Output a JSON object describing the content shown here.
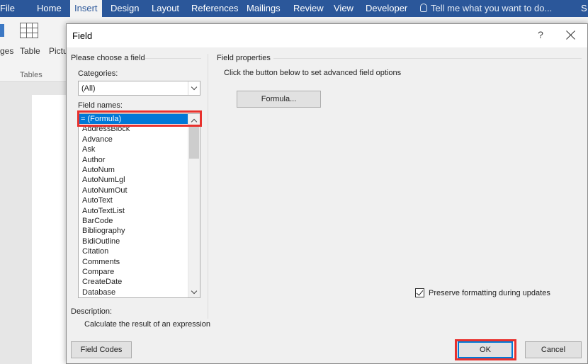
{
  "ribbon": {
    "tabs": [
      "File",
      "Home",
      "Insert",
      "Design",
      "Layout",
      "References",
      "Mailings",
      "Review",
      "View",
      "Developer"
    ],
    "active_tab": "Insert",
    "tell_me": "Tell me what you want to do...",
    "share_initial": "S",
    "partial_left": "ges",
    "table_label": "Table",
    "pictures_partial": "Pictu",
    "tables_group": "Tables",
    "accent": "#2b579a"
  },
  "dialog": {
    "title": "Field",
    "help": "?",
    "left_section": "Please choose a field",
    "categories_label": "Categories:",
    "categories_value": "(All)",
    "field_names_label": "Field names:",
    "field_names": [
      "= (Formula)",
      "AddressBlock",
      "Advance",
      "Ask",
      "Author",
      "AutoNum",
      "AutoNumLgl",
      "AutoNumOut",
      "AutoText",
      "AutoTextList",
      "BarCode",
      "Bibliography",
      "BidiOutline",
      "Citation",
      "Comments",
      "Compare",
      "CreateDate",
      "Database"
    ],
    "selected_field": "= (Formula)",
    "right_section": "Field properties",
    "instruction": "Click the button below to set advanced field options",
    "formula_button": "Formula...",
    "preserve_label": "Preserve formatting during updates",
    "preserve_checked": true,
    "description_label": "Description:",
    "description_text": "Calculate the result of an expression",
    "field_codes_button": "Field Codes",
    "ok_button": "OK",
    "cancel_button": "Cancel",
    "highlight_color": "#e8312d",
    "selection_color": "#0078d7"
  }
}
